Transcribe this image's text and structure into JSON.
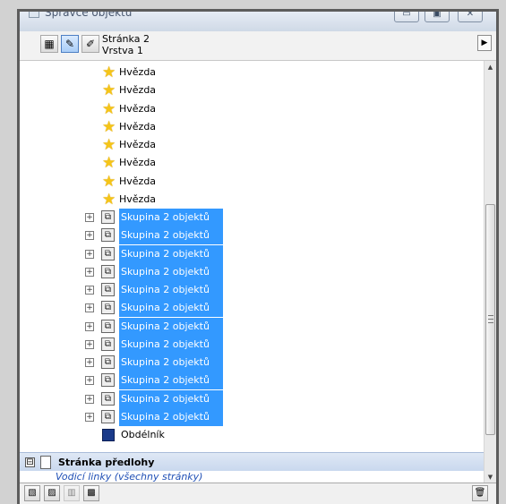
{
  "window": {
    "title": "Správce objektů",
    "buttons": {
      "minimize": "▭",
      "maximize": "▣",
      "close": "✕"
    }
  },
  "toolbar": {
    "page_name": "Stránka 2",
    "layer_name": "Vrstva 1",
    "buttons": [
      "show-object-properties-icon",
      "edit-across-layers-icon",
      "layer-manager-view-icon"
    ],
    "menu_arrow": "▶"
  },
  "tree": {
    "stars": [
      {
        "label": "Hvězda"
      },
      {
        "label": "Hvězda"
      },
      {
        "label": "Hvězda"
      },
      {
        "label": "Hvězda"
      },
      {
        "label": "Hvězda"
      },
      {
        "label": "Hvězda"
      },
      {
        "label": "Hvězda"
      },
      {
        "label": "Hvězda"
      }
    ],
    "groups": [
      {
        "label": "Skupina 2 objektů"
      },
      {
        "label": "Skupina 2 objektů"
      },
      {
        "label": "Skupina 2 objektů"
      },
      {
        "label": "Skupina 2 objektů"
      },
      {
        "label": "Skupina 2 objektů"
      },
      {
        "label": "Skupina 2 objektů"
      },
      {
        "label": "Skupina 2 objektů"
      },
      {
        "label": "Skupina 2 objektů"
      },
      {
        "label": "Skupina 2 objektů"
      },
      {
        "label": "Skupina 2 objektů"
      },
      {
        "label": "Skupina 2 objektů"
      },
      {
        "label": "Skupina 2 objektů"
      }
    ],
    "rectangle": {
      "label": "Obdélník",
      "color": "#1a3a8a"
    },
    "master_page": {
      "label": "Stránka předlohy",
      "expander": "⊟"
    },
    "cut_off_row": "Vodicí linky (všechny stránky)",
    "expander_symbol": "⊞"
  },
  "colors": {
    "selection": "#3399ff",
    "star": "#f5c518"
  },
  "bottom_toolbar": {
    "buttons": [
      "new-layer-icon",
      "new-master-layer-icon",
      "new-master-layer-odd-icon",
      "new-master-layer-all-icon"
    ],
    "delete": "🗑"
  }
}
